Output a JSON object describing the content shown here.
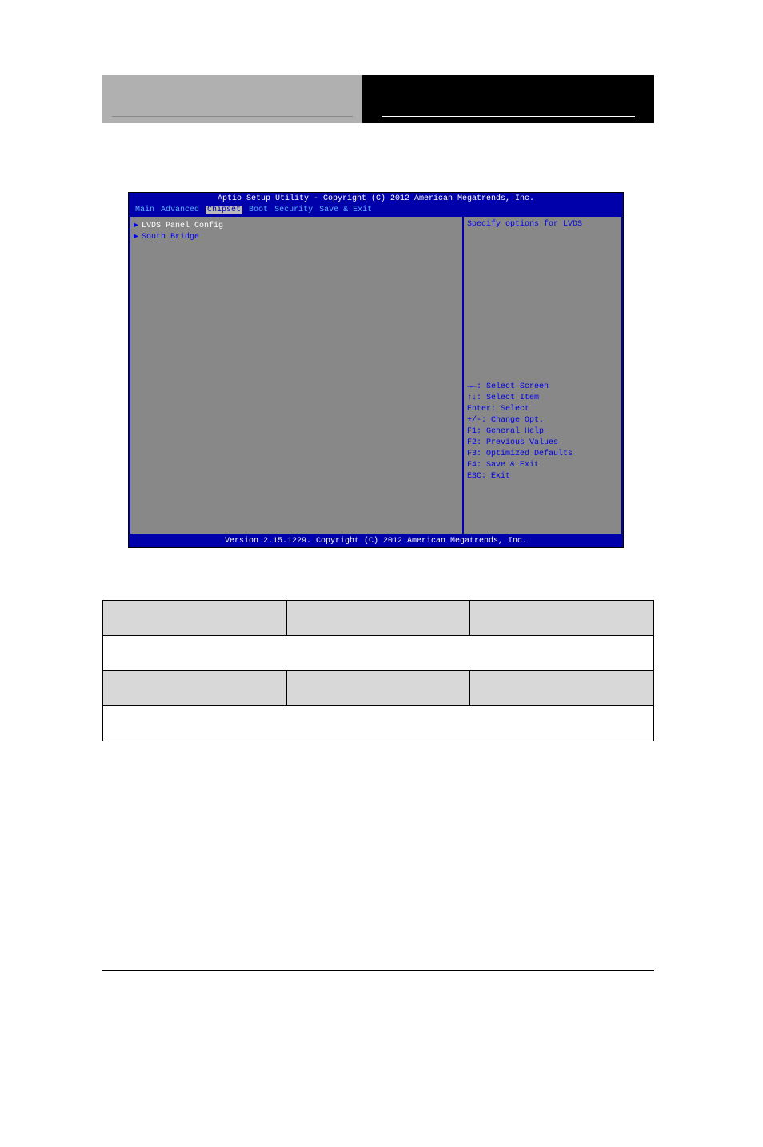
{
  "bios": {
    "title": "Aptio Setup Utility - Copyright (C) 2012 American Megatrends, Inc.",
    "menu": {
      "items": [
        "Main",
        "Advanced",
        "Chipset",
        "Boot",
        "Security",
        "Save & Exit"
      ],
      "active_index": 2
    },
    "left_panel": {
      "items": [
        {
          "label": "LVDS Panel Config",
          "selected": true
        },
        {
          "label": "South Bridge",
          "selected": false
        }
      ]
    },
    "right_panel": {
      "help_text": "Specify options for LVDS",
      "keys": [
        "→←: Select Screen",
        "↑↓: Select Item",
        "Enter: Select",
        "+/-: Change Opt.",
        "F1: General Help",
        "F2: Previous Values",
        "F3: Optimized Defaults",
        "F4: Save & Exit",
        "ESC: Exit"
      ]
    },
    "footer": "Version 2.15.1229. Copyright (C) 2012 American Megatrends, Inc."
  },
  "table": {
    "rows": [
      {
        "cells": [
          {
            "bg": "gray"
          },
          {
            "bg": "gray"
          },
          {
            "bg": "gray"
          }
        ]
      },
      {
        "cells": [
          {
            "bg": "white",
            "colspan": 3
          }
        ]
      },
      {
        "cells": [
          {
            "bg": "gray"
          },
          {
            "bg": "gray"
          },
          {
            "bg": "gray"
          }
        ]
      },
      {
        "cells": [
          {
            "bg": "white",
            "colspan": 3
          }
        ]
      }
    ]
  }
}
